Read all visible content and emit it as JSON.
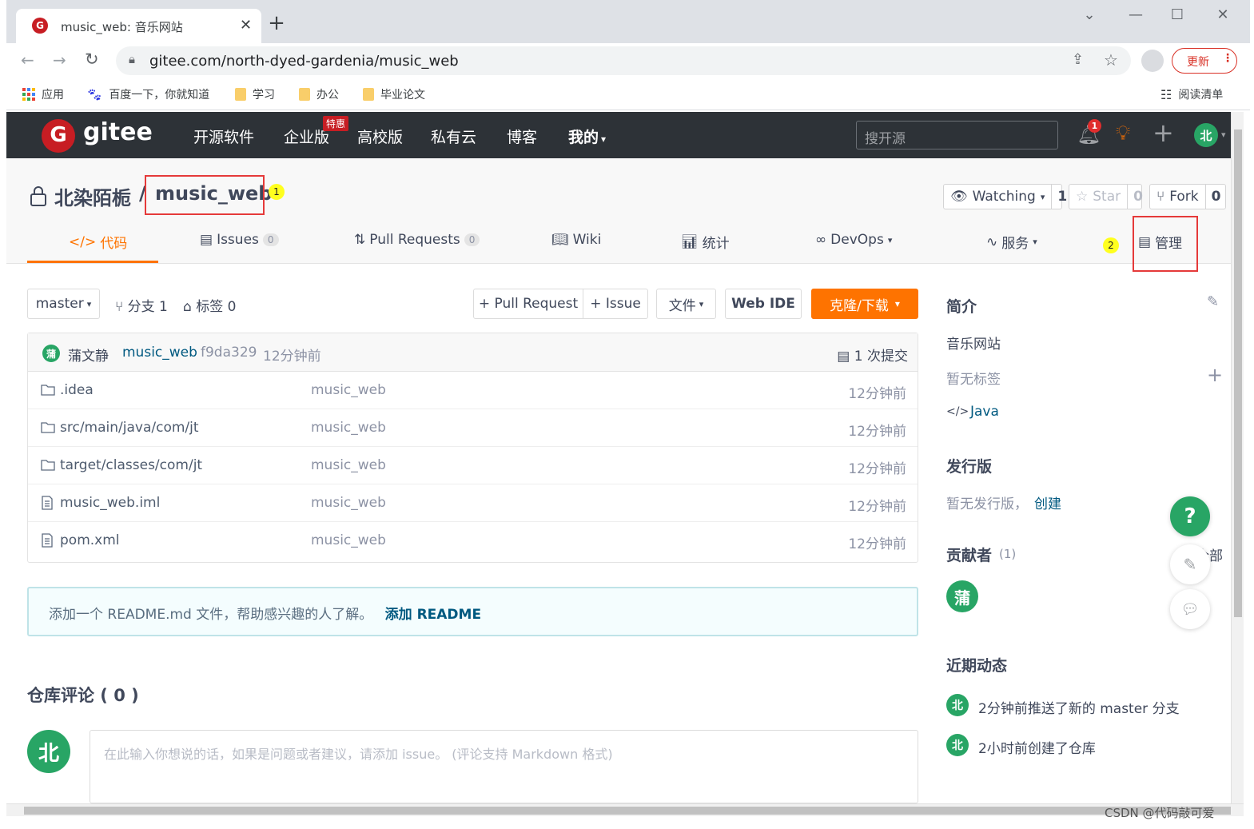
{
  "browser": {
    "tab_title": "music_web: 音乐网站",
    "url": "gitee.com/north-dyed-gardenia/music_web",
    "update_label": "更新",
    "bookmarks": [
      {
        "label": "应用"
      },
      {
        "label": "百度一下，你就知道"
      },
      {
        "label": "学习"
      },
      {
        "label": "办公"
      },
      {
        "label": "毕业论文"
      }
    ],
    "reading_list": "阅读清单"
  },
  "gitee_nav": {
    "logo_text": "gitee",
    "links": [
      "开源软件",
      "企业版",
      "高校版",
      "私有云",
      "博客",
      "我的"
    ],
    "promo_badge": "特惠",
    "search_placeholder": "搜开源",
    "notification_count": "1",
    "user_initial": "北"
  },
  "repo": {
    "owner": "北染陌栀",
    "separator": "/",
    "name": "music_web",
    "watching_label": "Watching",
    "watching_count": "1",
    "star_label": "Star",
    "star_count": "0",
    "fork_label": "Fork",
    "fork_count": "0",
    "tabs": [
      {
        "label": "代码"
      },
      {
        "label": "Issues",
        "count": "0"
      },
      {
        "label": "Pull Requests",
        "count": "0"
      },
      {
        "label": "Wiki"
      },
      {
        "label": "统计"
      },
      {
        "label": "DevOps"
      },
      {
        "label": "服务"
      },
      {
        "label": "管理"
      }
    ]
  },
  "toolbar": {
    "branch": "master",
    "branches_label": "分支 1",
    "tags_label": "标签 0",
    "pull_request_btn": "+ Pull Request",
    "issue_btn": "+ Issue",
    "file_btn": "文件",
    "webide_btn": "Web IDE",
    "clone_btn": "克隆/下载"
  },
  "commit": {
    "author_initial": "蒲",
    "author": "蒲文静",
    "message": "music_web",
    "hash": "f9da329",
    "time": "12分钟前",
    "commit_count_label": "1 次提交"
  },
  "files": [
    {
      "name": ".idea",
      "type": "folder",
      "message": "music_web",
      "time": "12分钟前"
    },
    {
      "name": "src/main/java/com/jt",
      "type": "folder",
      "message": "music_web",
      "time": "12分钟前"
    },
    {
      "name": "target/classes/com/jt",
      "type": "folder",
      "message": "music_web",
      "time": "12分钟前"
    },
    {
      "name": "music_web.iml",
      "type": "file",
      "message": "music_web",
      "time": "12分钟前"
    },
    {
      "name": "pom.xml",
      "type": "file",
      "message": "music_web",
      "time": "12分钟前"
    }
  ],
  "readme_tip": {
    "text": "添加一个 README.md 文件，帮助感兴趣的人了解。",
    "link": "添加 README"
  },
  "comments": {
    "title": "仓库评论 ( 0 )",
    "user_initial": "北",
    "placeholder": "在此输入你想说的话，如果是问题或者建议，请添加 issue。 (评论支持 Markdown 格式)"
  },
  "sidebar": {
    "intro_title": "简介",
    "description": "音乐网站",
    "no_tags": "暂无标签",
    "language": "Java",
    "release_title": "发行版",
    "no_release": "暂无发行版，",
    "create_link": "创建",
    "contributors_title": "贡献者",
    "contributors_count": "(1)",
    "all_link": "全部",
    "contributor_initial": "蒲",
    "activity_title": "近期动态",
    "activities": [
      {
        "initial": "北",
        "text": "2分钟前推送了新的 master 分支"
      },
      {
        "initial": "北",
        "text": "2小时前创建了仓库"
      }
    ]
  },
  "annotations": {
    "marker1": "1",
    "marker2": "2"
  },
  "watermark": "CSDN @代码敲可爱",
  "colors": {
    "brand_red": "#c71d23",
    "accent_orange": "#fe7300",
    "nav_bg": "#2d3237",
    "green": "#28a565"
  }
}
